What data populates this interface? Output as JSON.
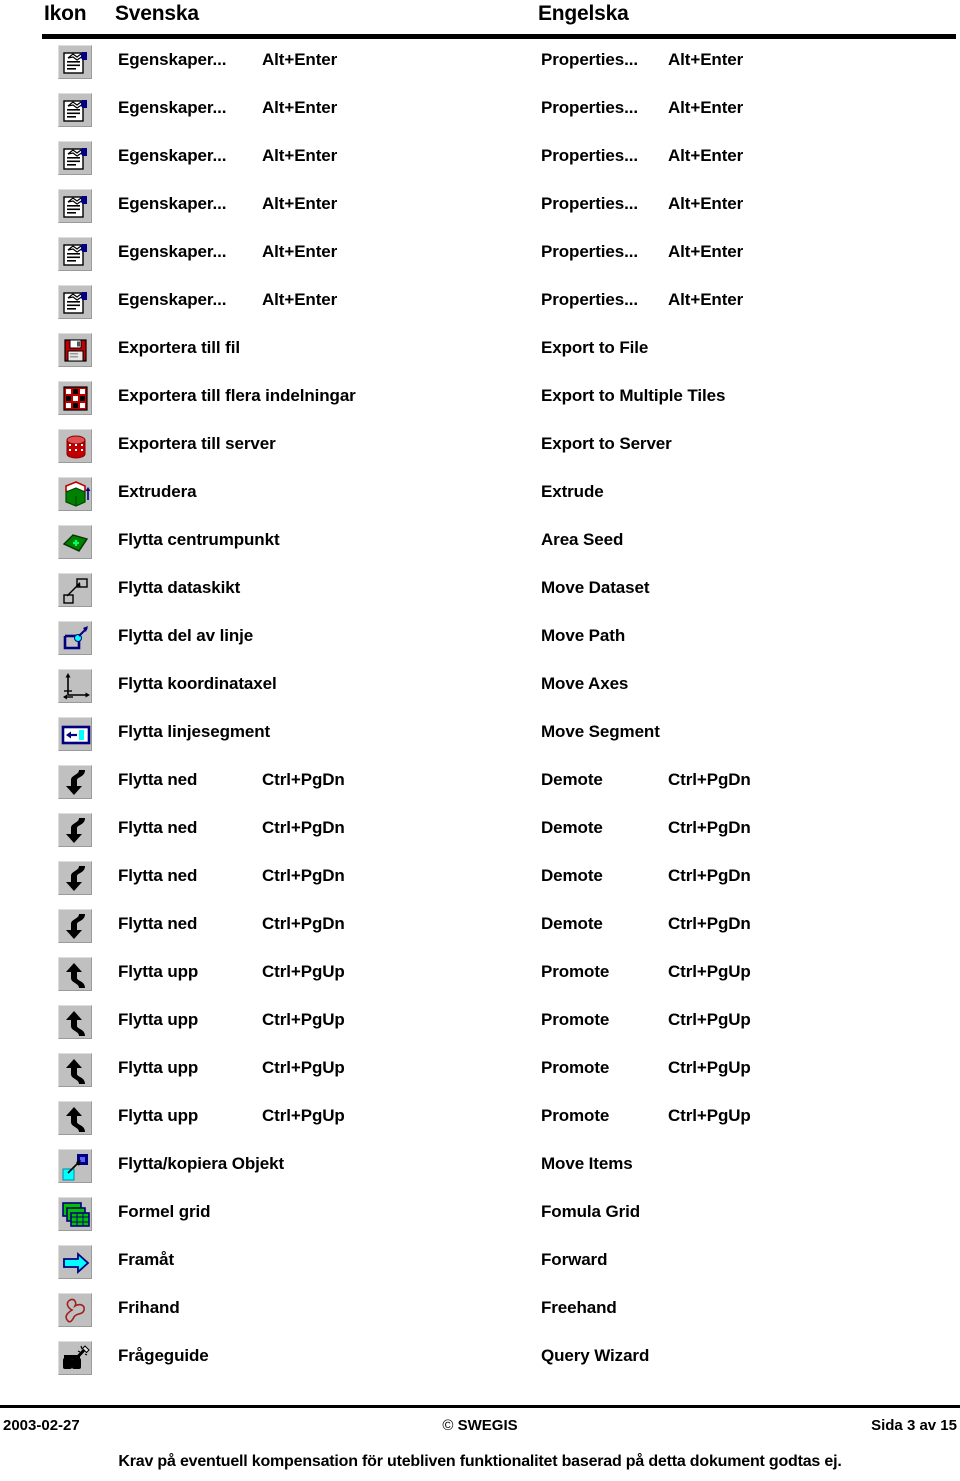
{
  "header": {
    "icon_column": "Ikon",
    "swedish_column": "Svenska",
    "english_column": "Engelska"
  },
  "rows": [
    {
      "icon": "properties-icon",
      "sv": "Egenskaper...",
      "sv_key": "Alt+Enter",
      "en": "Properties...",
      "en_key": "Alt+Enter"
    },
    {
      "icon": "properties-icon",
      "sv": "Egenskaper...",
      "sv_key": "Alt+Enter",
      "en": "Properties...",
      "en_key": "Alt+Enter"
    },
    {
      "icon": "properties-icon",
      "sv": "Egenskaper...",
      "sv_key": "Alt+Enter",
      "en": "Properties...",
      "en_key": "Alt+Enter"
    },
    {
      "icon": "properties-icon",
      "sv": "Egenskaper...",
      "sv_key": "Alt+Enter",
      "en": "Properties...",
      "en_key": "Alt+Enter"
    },
    {
      "icon": "properties-icon",
      "sv": "Egenskaper...",
      "sv_key": "Alt+Enter",
      "en": "Properties...",
      "en_key": "Alt+Enter"
    },
    {
      "icon": "properties-icon",
      "sv": "Egenskaper...",
      "sv_key": "Alt+Enter",
      "en": "Properties...",
      "en_key": "Alt+Enter"
    },
    {
      "icon": "floppy-disk-icon",
      "sv": "Exportera till fil",
      "sv_key": "",
      "en": "Export to File",
      "en_key": ""
    },
    {
      "icon": "multiple-tiles-icon",
      "sv": "Exportera till flera indelningar",
      "sv_key": "",
      "en": "Export to Multiple Tiles",
      "en_key": ""
    },
    {
      "icon": "database-cylinder-icon",
      "sv": "Exportera till server",
      "sv_key": "",
      "en": "Export to Server",
      "en_key": ""
    },
    {
      "icon": "extrude-icon",
      "sv": "Extrudera",
      "sv_key": "",
      "en": "Extrude",
      "en_key": ""
    },
    {
      "icon": "area-seed-icon",
      "sv": "Flytta centrumpunkt",
      "sv_key": "",
      "en": "Area Seed",
      "en_key": ""
    },
    {
      "icon": "move-dataset-icon",
      "sv": "Flytta dataskikt",
      "sv_key": "",
      "en": "Move Dataset",
      "en_key": ""
    },
    {
      "icon": "move-path-icon",
      "sv": "Flytta del av linje",
      "sv_key": "",
      "en": "Move Path",
      "en_key": ""
    },
    {
      "icon": "move-axes-icon",
      "sv": "Flytta koordinataxel",
      "sv_key": "",
      "en": "Move Axes",
      "en_key": ""
    },
    {
      "icon": "move-segment-icon",
      "sv": "Flytta linjesegment",
      "sv_key": "",
      "en": "Move Segment",
      "en_key": ""
    },
    {
      "icon": "demote-arrow-down-icon",
      "sv": "Flytta ned",
      "sv_key": "Ctrl+PgDn",
      "en": "Demote",
      "en_key": "Ctrl+PgDn"
    },
    {
      "icon": "demote-arrow-down-icon",
      "sv": "Flytta ned",
      "sv_key": "Ctrl+PgDn",
      "en": "Demote",
      "en_key": "Ctrl+PgDn"
    },
    {
      "icon": "demote-arrow-down-icon",
      "sv": "Flytta ned",
      "sv_key": "Ctrl+PgDn",
      "en": "Demote",
      "en_key": "Ctrl+PgDn"
    },
    {
      "icon": "demote-arrow-down-icon",
      "sv": "Flytta ned",
      "sv_key": "Ctrl+PgDn",
      "en": "Demote",
      "en_key": "Ctrl+PgDn"
    },
    {
      "icon": "promote-arrow-up-icon",
      "sv": "Flytta upp",
      "sv_key": "Ctrl+PgUp",
      "en": "Promote",
      "en_key": "Ctrl+PgUp"
    },
    {
      "icon": "promote-arrow-up-icon",
      "sv": "Flytta upp",
      "sv_key": "Ctrl+PgUp",
      "en": "Promote",
      "en_key": "Ctrl+PgUp"
    },
    {
      "icon": "promote-arrow-up-icon",
      "sv": "Flytta upp",
      "sv_key": "Ctrl+PgUp",
      "en": "Promote",
      "en_key": "Ctrl+PgUp"
    },
    {
      "icon": "promote-arrow-up-icon",
      "sv": "Flytta upp",
      "sv_key": "Ctrl+PgUp",
      "en": "Promote",
      "en_key": "Ctrl+PgUp"
    },
    {
      "icon": "move-items-icon",
      "sv": "Flytta/kopiera Objekt",
      "sv_key": "",
      "en": "Move Items",
      "en_key": ""
    },
    {
      "icon": "formula-grid-icon",
      "sv": "Formel grid",
      "sv_key": "",
      "en": "Fomula Grid",
      "en_key": ""
    },
    {
      "icon": "forward-arrow-icon",
      "sv": "Framåt",
      "sv_key": "",
      "en": "Forward",
      "en_key": ""
    },
    {
      "icon": "freehand-icon",
      "sv": "Frihand",
      "sv_key": "",
      "en": "Freehand",
      "en_key": ""
    },
    {
      "icon": "query-wizard-icon",
      "sv": "Frågeguide",
      "sv_key": "",
      "en": "Query Wizard",
      "en_key": ""
    }
  ],
  "footer": {
    "date": "2003-02-27",
    "copyright_mark": "©",
    "copyright_owner": "SWEGIS",
    "page": "Sida 3 av 15",
    "disclaimer": "Krav på eventuell kompensation för utebliven funktionalitet baserad på detta dokument godtas ej."
  },
  "colors": {
    "button_face": "#c0c0c0",
    "icon_red": "#c00000",
    "icon_blue": "#000080",
    "icon_green": "#008000",
    "icon_cyan": "#00ffff",
    "text": "#000000"
  }
}
